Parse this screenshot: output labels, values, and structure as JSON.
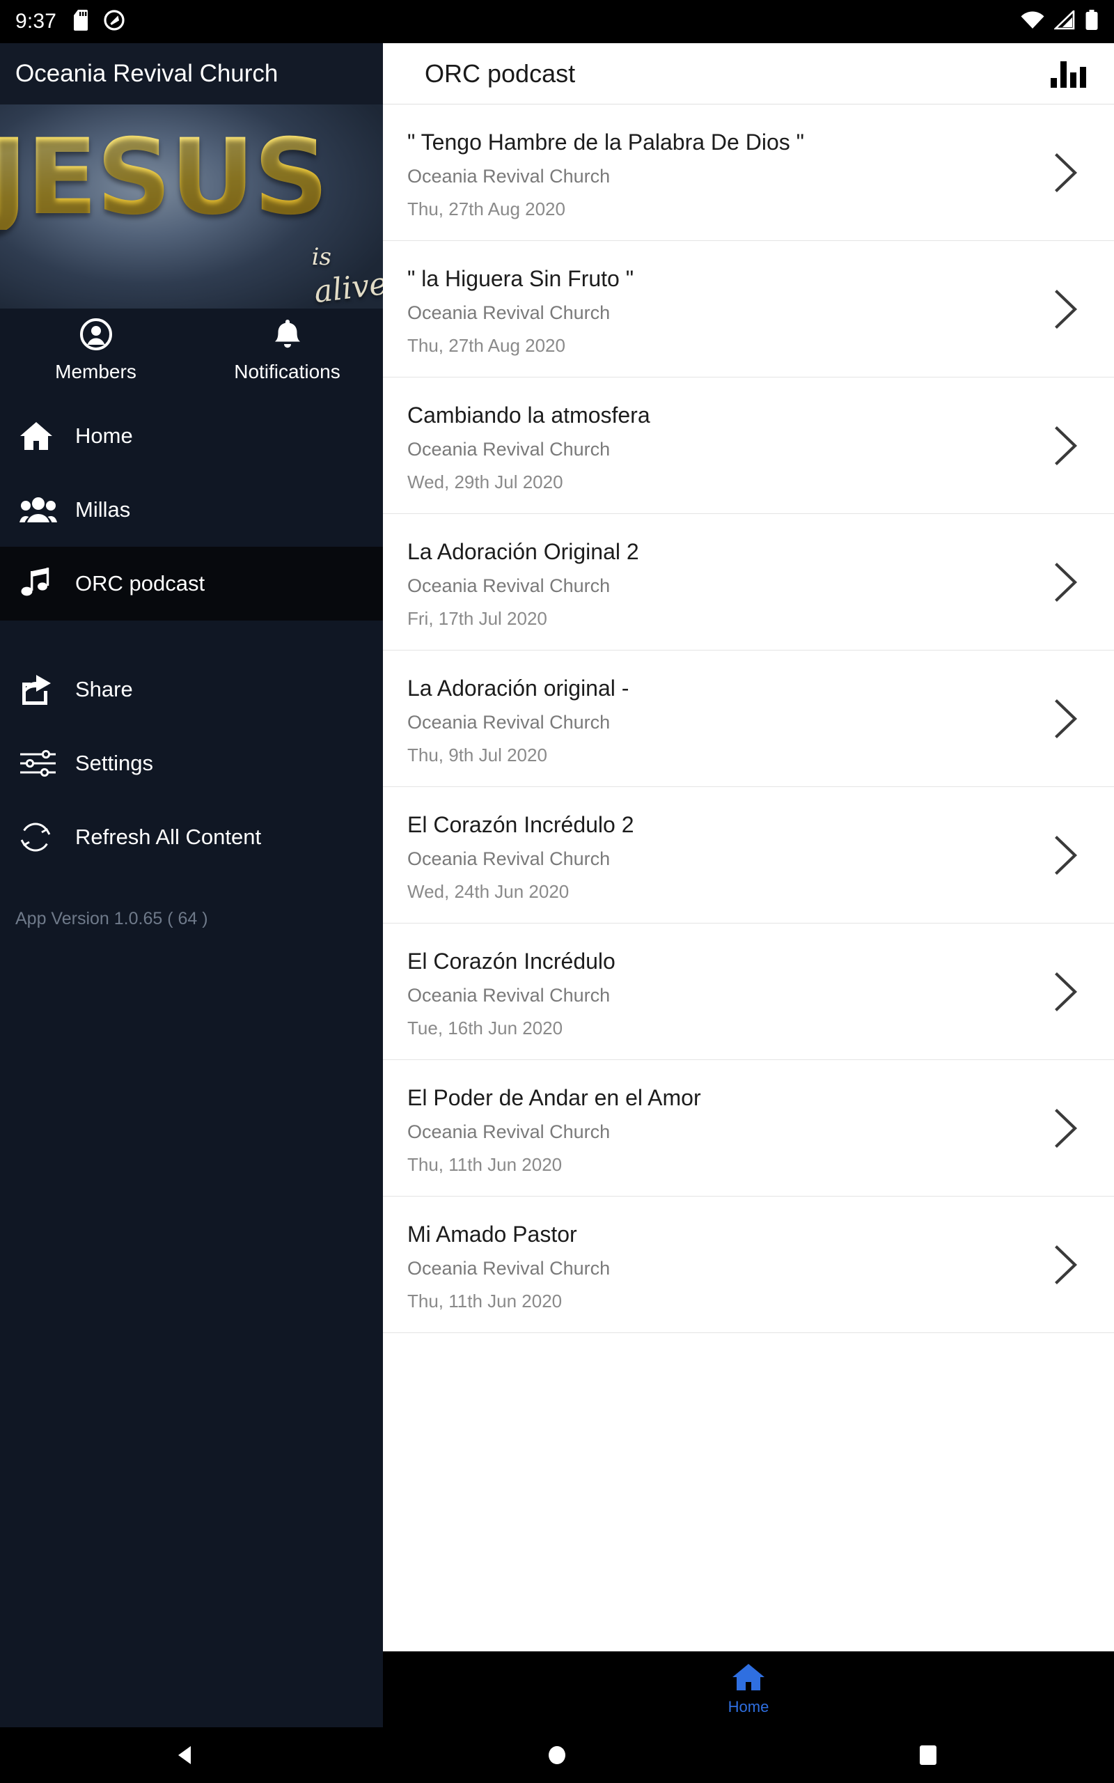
{
  "status_bar": {
    "time": "9:37",
    "left_icons": [
      "sd-card-icon",
      "do-not-disturb-icon"
    ],
    "right_icons": [
      "wifi-icon",
      "cellular-signal-icon",
      "battery-icon"
    ]
  },
  "drawer": {
    "title": "Oceania Revival Church",
    "hero": {
      "word": "JESUS",
      "sub1": "is",
      "sub2": "alive"
    },
    "quick_actions": [
      {
        "label": "Members",
        "icon": "person-circle-icon"
      },
      {
        "label": "Notifications",
        "icon": "bell-icon"
      }
    ],
    "nav_items": [
      {
        "label": "Home",
        "icon": "home-icon",
        "selected": false
      },
      {
        "label": "Millas",
        "icon": "people-group-icon",
        "selected": false
      },
      {
        "label": "ORC podcast",
        "icon": "music-note-icon",
        "selected": true
      }
    ],
    "secondary_items": [
      {
        "label": "Share",
        "icon": "share-icon"
      },
      {
        "label": "Settings",
        "icon": "sliders-icon"
      },
      {
        "label": "Refresh All Content",
        "icon": "refresh-icon"
      }
    ],
    "app_version": "App Version 1.0.65 ( 64 )"
  },
  "app_bar": {
    "title": "ORC podcast",
    "action_icon": "equalizer-icon"
  },
  "podcast_list": [
    {
      "title": "\" Tengo Hambre de la Palabra De Dios \"",
      "subtitle": "Oceania Revival Church",
      "date": "Thu, 27th Aug 2020"
    },
    {
      "title": "\" la Higuera Sin Fruto \"",
      "subtitle": "Oceania Revival Church",
      "date": "Thu, 27th Aug 2020"
    },
    {
      "title": "Cambiando la atmosfera",
      "subtitle": "Oceania Revival Church",
      "date": "Wed, 29th Jul 2020"
    },
    {
      "title": "La Adoración Original 2",
      "subtitle": "Oceania Revival Church",
      "date": "Fri, 17th Jul 2020"
    },
    {
      "title": "La Adoración original -",
      "subtitle": "Oceania Revival Church",
      "date": "Thu, 9th Jul 2020"
    },
    {
      "title": "El Corazón Incrédulo 2",
      "subtitle": "Oceania Revival Church",
      "date": "Wed, 24th Jun 2020"
    },
    {
      "title": "El Corazón Incrédulo",
      "subtitle": "Oceania Revival Church",
      "date": "Tue, 16th Jun 2020"
    },
    {
      "title": "El Poder de Andar en el Amor",
      "subtitle": "Oceania Revival Church",
      "date": "Thu, 11th Jun 2020"
    },
    {
      "title": "Mi Amado Pastor",
      "subtitle": "Oceania Revival Church",
      "date": "Thu, 11th Jun 2020"
    }
  ],
  "bottom_nav": {
    "items": [
      {
        "label": "Home",
        "icon": "home-icon",
        "active": true
      }
    ],
    "active_color": "#2f6fe0"
  },
  "system_nav": {
    "buttons": [
      "back-button",
      "home-button",
      "recents-button"
    ]
  },
  "colors": {
    "drawer_bg": "#101724",
    "drawer_selected_bg": "#07090d",
    "accent": "#2f6fe0",
    "hero_gold": "#e8c53a"
  }
}
